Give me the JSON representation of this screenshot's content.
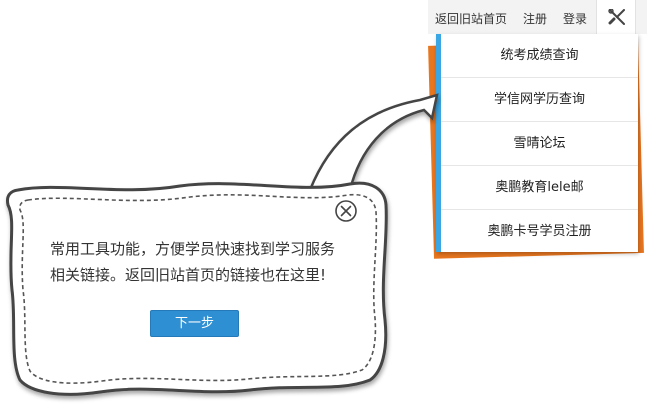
{
  "topbar": {
    "links": [
      "返回旧站首页",
      "注册",
      "登录"
    ],
    "tool_icon": "wrench-screwdriver-icon"
  },
  "menu": {
    "items": [
      "统考成绩查询",
      "学信网学历查询",
      "雪晴论坛",
      "奥鹏教育lele邮",
      "奥鹏卡号学员注册"
    ]
  },
  "tip": {
    "lines": [
      "常用工具功能，方便学员快速找到学习服务",
      "相关链接。返回旧站首页的链接也在这里!"
    ],
    "next_label": "下一步",
    "close_icon": "close-circle-icon"
  },
  "colors": {
    "accent_blue": "#3aa6e3",
    "button_blue": "#2f8fd3",
    "orange": "#e8761f"
  }
}
